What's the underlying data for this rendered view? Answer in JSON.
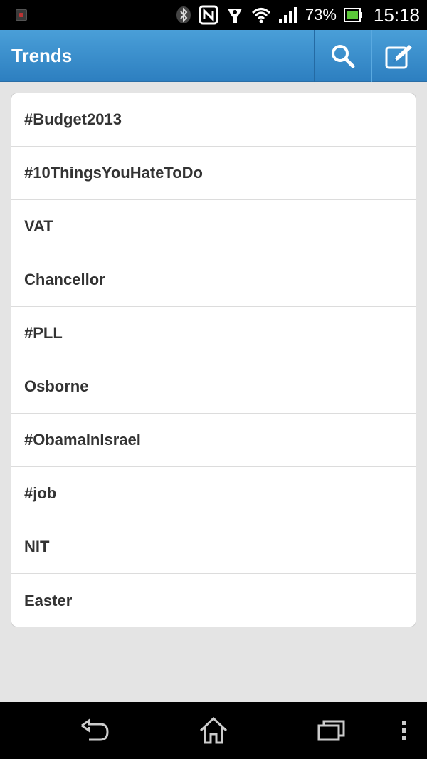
{
  "status_bar": {
    "battery_percent": "73%",
    "time": "15:18",
    "icons": [
      "notification-icon",
      "bluetooth-icon",
      "nfc-icon",
      "app-icon",
      "wifi-icon",
      "signal-icon",
      "battery-icon"
    ]
  },
  "action_bar": {
    "title": "Trends",
    "search_icon": "search-icon",
    "compose_icon": "compose-icon",
    "color": "#3b8ccc"
  },
  "trends": [
    {
      "label": "#Budget2013"
    },
    {
      "label": "#10ThingsYouHateToDo"
    },
    {
      "label": "VAT"
    },
    {
      "label": "Chancellor"
    },
    {
      "label": "#PLL"
    },
    {
      "label": "Osborne"
    },
    {
      "label": "#ObamaInIsrael"
    },
    {
      "label": "#job"
    },
    {
      "label": "NIT"
    },
    {
      "label": "Easter"
    }
  ],
  "nav_bar": {
    "icons": [
      "back-icon",
      "home-icon",
      "recent-apps-icon",
      "menu-icon"
    ]
  }
}
